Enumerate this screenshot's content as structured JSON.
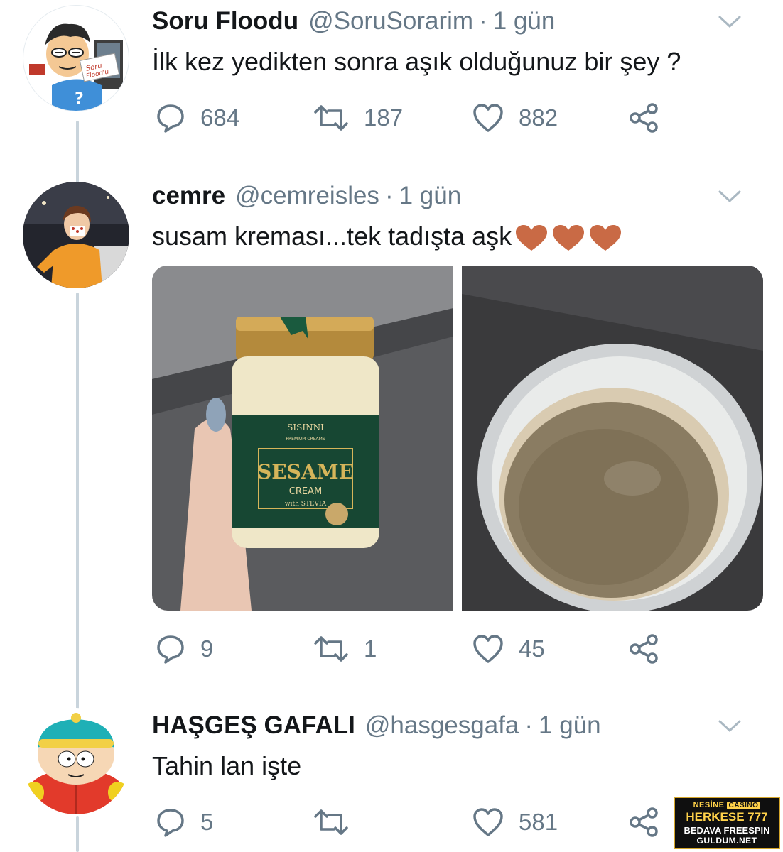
{
  "colors": {
    "accent": "#1da1f2",
    "muted": "#657786",
    "text": "#14171a",
    "thread": "#c9d4dc"
  },
  "tweets": [
    {
      "name": "Soru Floodu",
      "handle": "@SoruSorarim",
      "separator": "·",
      "time": "1 gün",
      "text": "İlk kez yedikten sonra aşık olduğunuz bir şey ?",
      "replies": "684",
      "retweets": "187",
      "likes": "882",
      "avatar_icon": "cartoon-question-avatar",
      "avatar_text": "Soru Flood'u"
    },
    {
      "name": "cemre",
      "handle": "@cemreisles",
      "separator": "·",
      "time": "1 gün",
      "text": "susam kreması...tek tadışta aşk",
      "emoji": "heart-emoji",
      "replies": "9",
      "retweets": "1",
      "likes": "45",
      "avatar_icon": "person-photo-avatar",
      "media": {
        "jar_brand": "SISINNI",
        "jar_subtitle": "PREMIUM CREAMS",
        "jar_title": "SESAME",
        "jar_type": "CREAM",
        "jar_note": "with STEVIA"
      }
    },
    {
      "name": "HAŞGEŞ GAFALI",
      "handle": "@hasgesgafa",
      "separator": "·",
      "time": "1 gün",
      "text": "Tahin lan işte",
      "replies": "5",
      "retweets": "",
      "likes": "581",
      "avatar_icon": "cartoon-cartman-avatar"
    }
  ],
  "ad": {
    "brand": "NESİNE",
    "brand_tag": "CASINO",
    "line1": "HERKESE 777",
    "line2": "BEDAVA FREESPIN",
    "line3": "GULDUM.NET"
  }
}
